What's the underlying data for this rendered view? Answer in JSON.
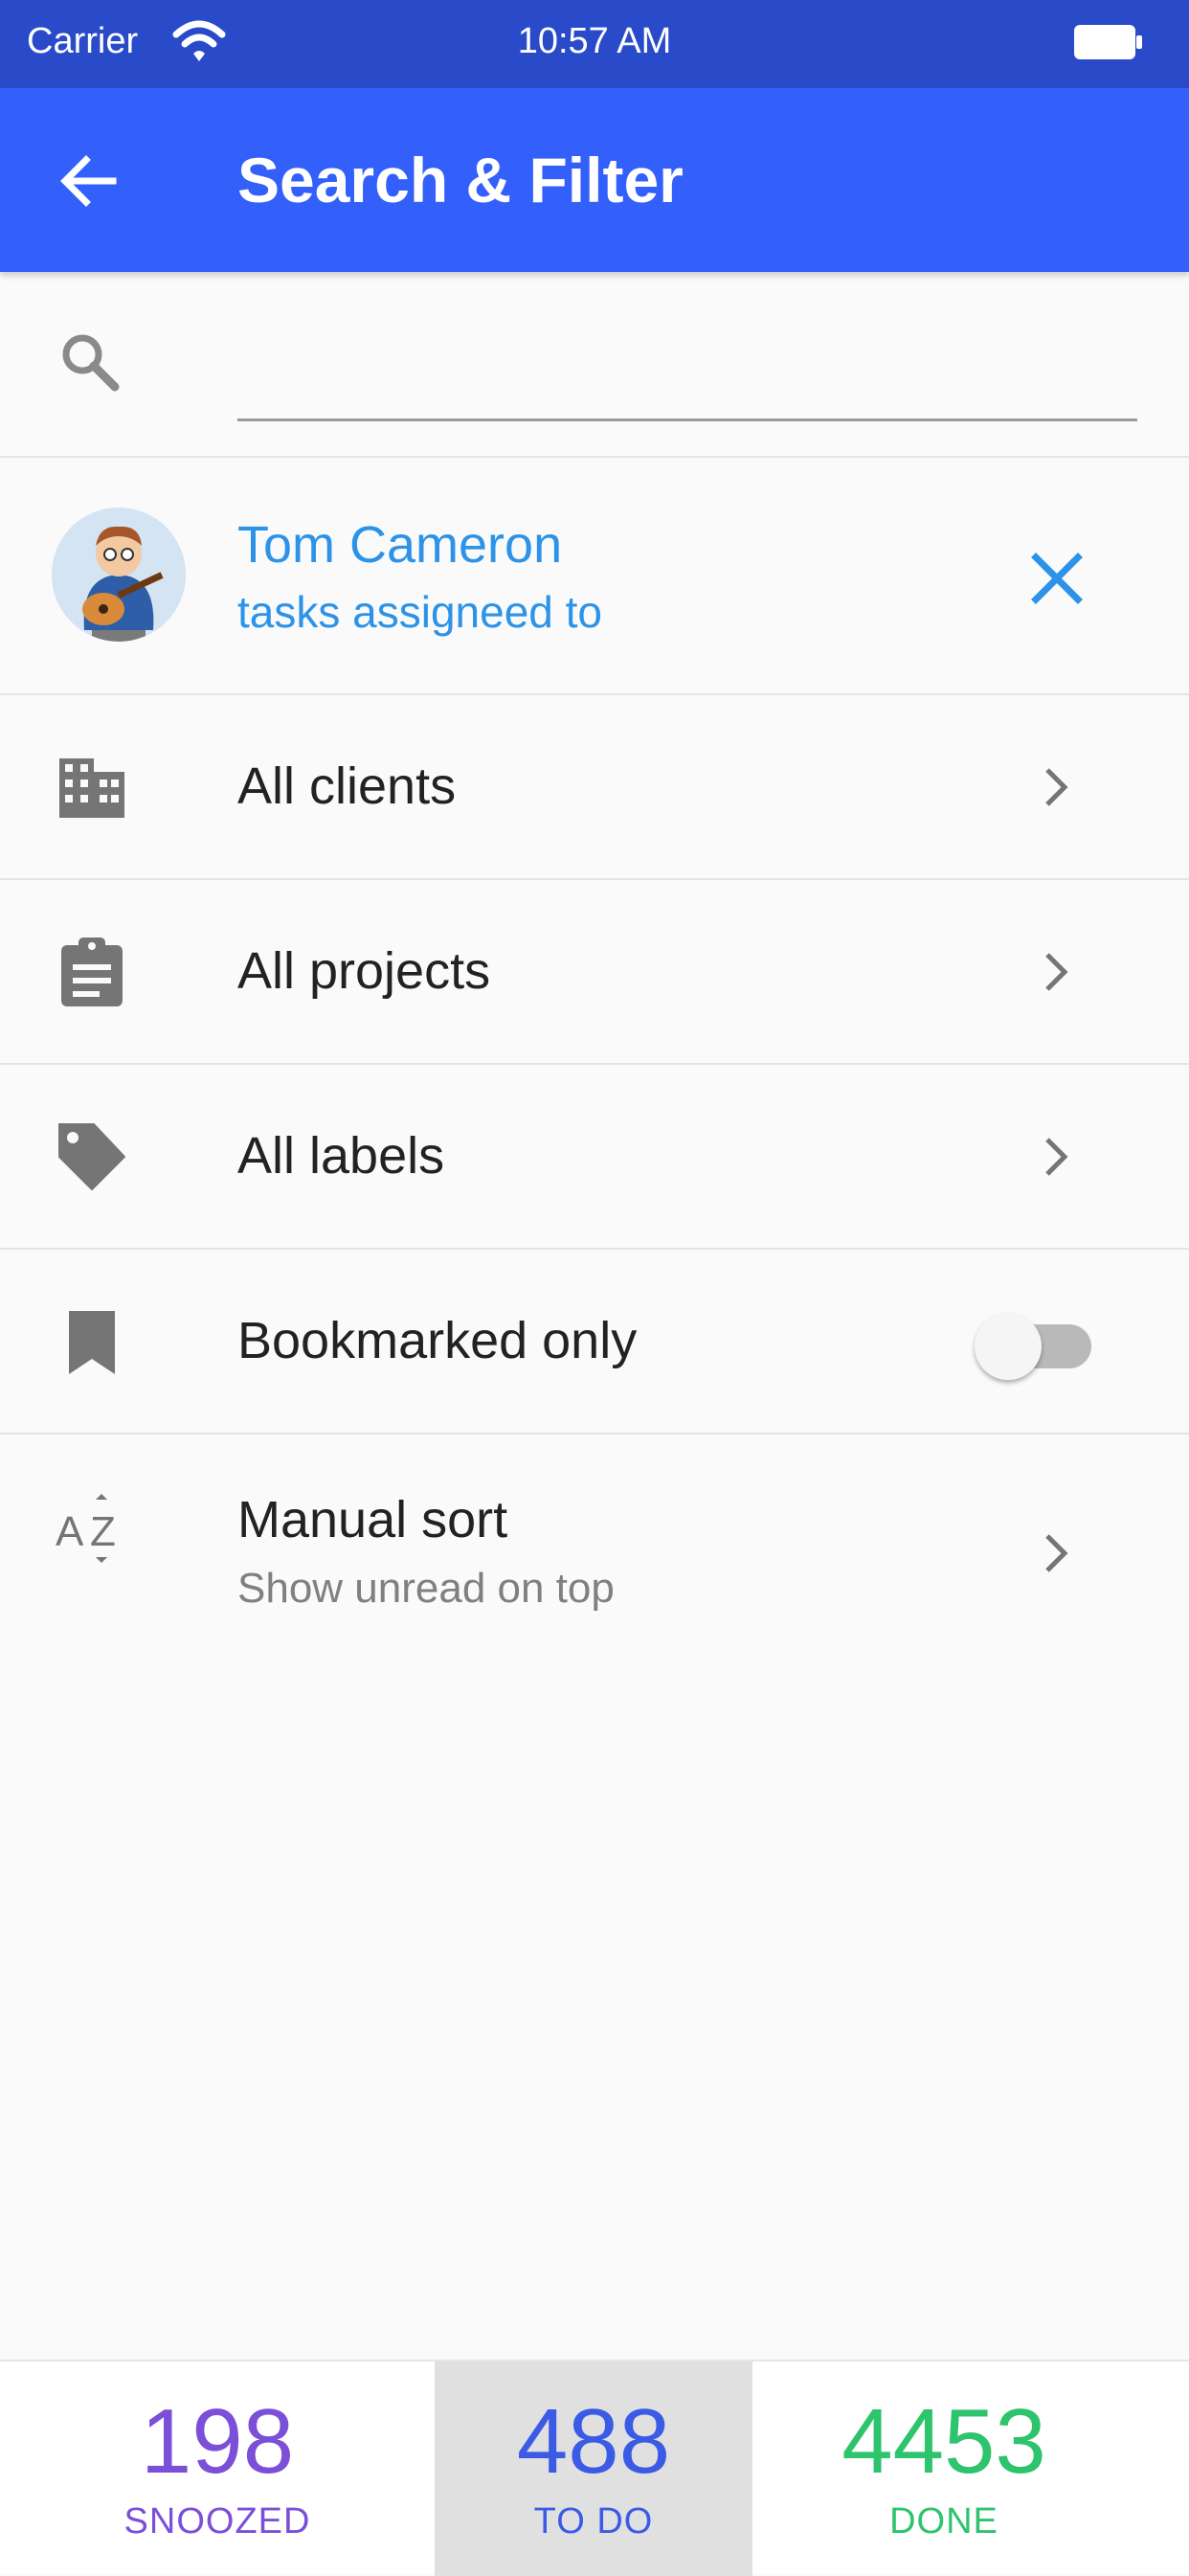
{
  "status_bar": {
    "carrier": "Carrier",
    "time": "10:57 AM"
  },
  "app_bar": {
    "title": "Search & Filter",
    "back_icon": "arrow-left-icon"
  },
  "search": {
    "value": "",
    "placeholder": "",
    "icon": "search-icon"
  },
  "assignee": {
    "name": "Tom Cameron",
    "subtitle": "tasks assigneed to",
    "clear_icon": "close-icon"
  },
  "filters": [
    {
      "label": "All clients",
      "icon": "building-icon"
    },
    {
      "label": "All projects",
      "icon": "clipboard-icon"
    },
    {
      "label": "All labels",
      "icon": "tag-icon"
    }
  ],
  "bookmarked": {
    "label": "Bookmarked only",
    "icon": "bookmark-icon",
    "enabled": false
  },
  "sort": {
    "label": "Manual sort",
    "sublabel": "Show unread on top",
    "icon": "sort-az-icon"
  },
  "stats": [
    {
      "value": "198",
      "caption": "SNOOZED",
      "color": "#7b4fd8",
      "selected": false
    },
    {
      "value": "488",
      "caption": "TO DO",
      "color": "#3b5be6",
      "selected": true
    },
    {
      "value": "4453",
      "caption": "DONE",
      "color": "#2ec46d",
      "selected": false
    }
  ],
  "colors": {
    "status_bar": "#2a4bc9",
    "app_bar": "#3360fb",
    "accent_blue": "#2c93e8",
    "icon_gray": "#757575"
  }
}
